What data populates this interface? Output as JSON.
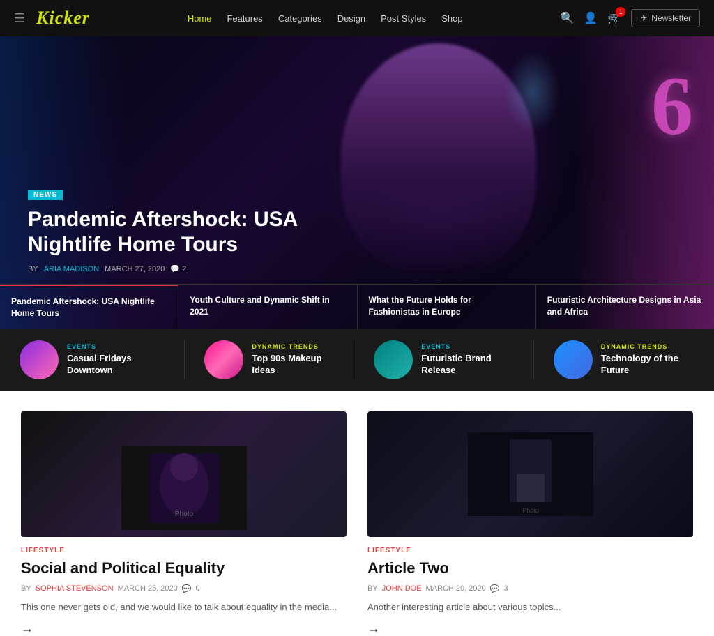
{
  "header": {
    "logo": "Kicker",
    "nav": [
      {
        "label": "Home",
        "active": true
      },
      {
        "label": "Features",
        "active": false
      },
      {
        "label": "Categories",
        "active": false
      },
      {
        "label": "Design",
        "active": false
      },
      {
        "label": "Post Styles",
        "active": false
      },
      {
        "label": "Shop",
        "active": false
      }
    ],
    "newsletter_label": "Newsletter",
    "cart_count": "1"
  },
  "hero": {
    "badge": "NEWS",
    "title": "Pandemic Aftershock: USA Nightlife Home Tours",
    "author_label": "BY",
    "author": "ARIA MADISON",
    "date": "MARCH 27, 2020",
    "comments": "2",
    "articles": [
      {
        "title": "Pandemic Aftershock: USA Nightlife Home Tours",
        "active": true
      },
      {
        "title": "Youth Culture and Dynamic Shift in 2021",
        "active": false
      },
      {
        "title": "What the Future Holds for Fashionistas in Europe",
        "active": false
      },
      {
        "title": "Futuristic Architecture Designs in Asia and Africa",
        "active": false
      }
    ]
  },
  "trending": [
    {
      "category": "EVENTS",
      "category_color": "cyan",
      "title": "Casual Fridays Downtown",
      "thumb_class": "thumb-purple"
    },
    {
      "category": "DYNAMIC TRENDS",
      "category_color": "yellow",
      "title": "Top 90s Makeup Ideas",
      "thumb_class": "thumb-pink"
    },
    {
      "category": "EVENTS",
      "category_color": "cyan",
      "title": "Futuristic Brand Release",
      "thumb_class": "thumb-teal"
    },
    {
      "category": "DYNAMIC TRENDS",
      "category_color": "yellow",
      "title": "Technology of the Future",
      "thumb_class": "thumb-blue"
    }
  ],
  "articles": [
    {
      "category": "LIFESTYLE",
      "title": "Social and Political Equality",
      "author": "SOPHIA STEVENSON",
      "date": "MARCH 25, 2020",
      "comments": "0",
      "excerpt": "This one never gets old, and we would like to talk about equality in the media..."
    },
    {
      "category": "LIFESTYLE",
      "title": "Article Two",
      "author": "JOHN DOE",
      "date": "MARCH 20, 2020",
      "comments": "3",
      "excerpt": "Another interesting article about various topics..."
    }
  ]
}
